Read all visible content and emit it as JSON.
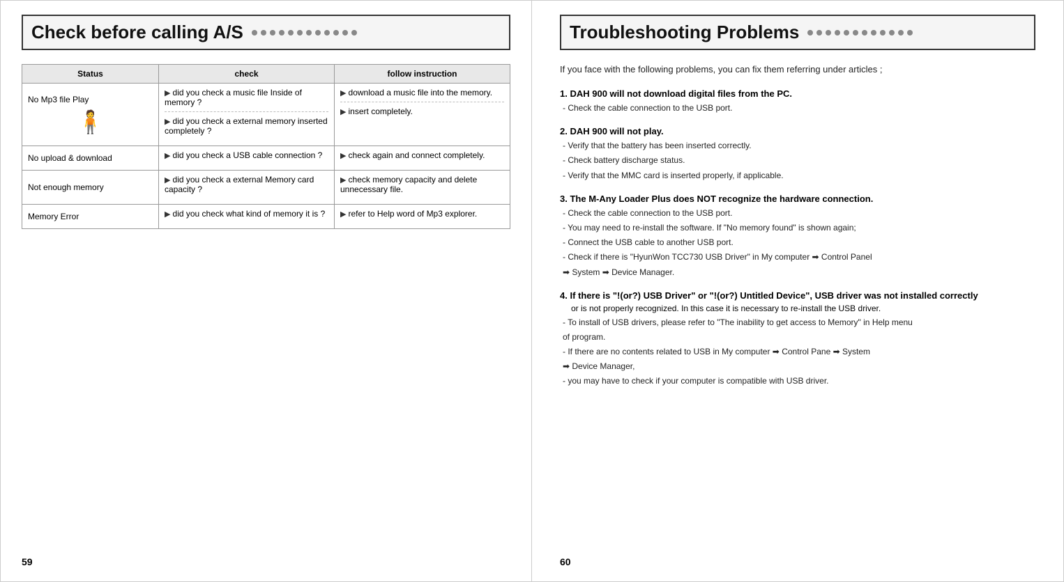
{
  "left": {
    "title": "Check before calling A/S",
    "page_number": "59",
    "table": {
      "headers": [
        "Status",
        "check",
        "follow instruction"
      ],
      "rows": [
        {
          "status": "No Mp3 file Play",
          "has_icon": true,
          "checks": [
            "did you check a music file Inside of memory ?",
            "did you check a external memory inserted completely ?"
          ],
          "follows": [
            "download a music file into the memory.",
            "insert completely."
          ],
          "check_border": true
        },
        {
          "status": "No upload & download",
          "has_icon": false,
          "checks": [
            "did you check a USB cable connection ?"
          ],
          "follows": [
            "check again and connect completely."
          ],
          "check_border": false
        },
        {
          "status": "Not enough memory",
          "has_icon": false,
          "checks": [
            "did you check a external Memory card capacity ?"
          ],
          "follows": [
            "check memory capacity and delete unnecessary file."
          ],
          "check_border": false
        },
        {
          "status": "Memory Error",
          "has_icon": false,
          "checks": [
            "did  you check what kind of memory it is ?"
          ],
          "follows": [
            "refer to Help word of Mp3 explorer."
          ],
          "check_border": false
        }
      ]
    }
  },
  "right": {
    "title": "Troubleshooting Problems",
    "page_number": "60",
    "intro": "If you face with the following problems, you can fix them referring under articles ;",
    "problems": [
      {
        "number": "1",
        "title": "DAH 900 will not download digital files from the PC.",
        "details": [
          "-  Check the cable connection to the USB port."
        ]
      },
      {
        "number": "2",
        "title": "DAH 900 will not play.",
        "details": [
          "-  Verify that the battery has been inserted correctly.",
          "-  Check battery discharge status.",
          "-  Verify that the MMC card is inserted properly, if applicable."
        ]
      },
      {
        "number": "3",
        "title": "The M-Any Loader Plus does NOT recognize the hardware connection.",
        "details": [
          "-  Check the cable connection to the USB port.",
          "-  You may need to re-install the software. If \"No memory found\" is shown again;",
          "  - Connect the USB cable to another USB port.",
          "  - Check if there is \"HyunWon TCC730 USB Driver\" in My computer ➡ Control Panel",
          "     ➡ System  ➡ Device Manager."
        ]
      },
      {
        "number": "4",
        "title": "If there is \"!(or?) USB Driver\" or \"!(or?) Untitled Device\", USB driver was not installed correctly",
        "title_cont": "   or is not properly recognized. In this case it is necessary to re-install the USB driver.",
        "details": [
          "- To install of USB drivers, please refer to \"The inability to get access to Memory\" in Help menu",
          "  of program.",
          "- If there are no contents related to USB in My computer ➡ Control Pane ➡ System",
          "   ➡ Device Manager,",
          "- you may have to check if your computer is compatible with USB driver."
        ]
      }
    ]
  }
}
